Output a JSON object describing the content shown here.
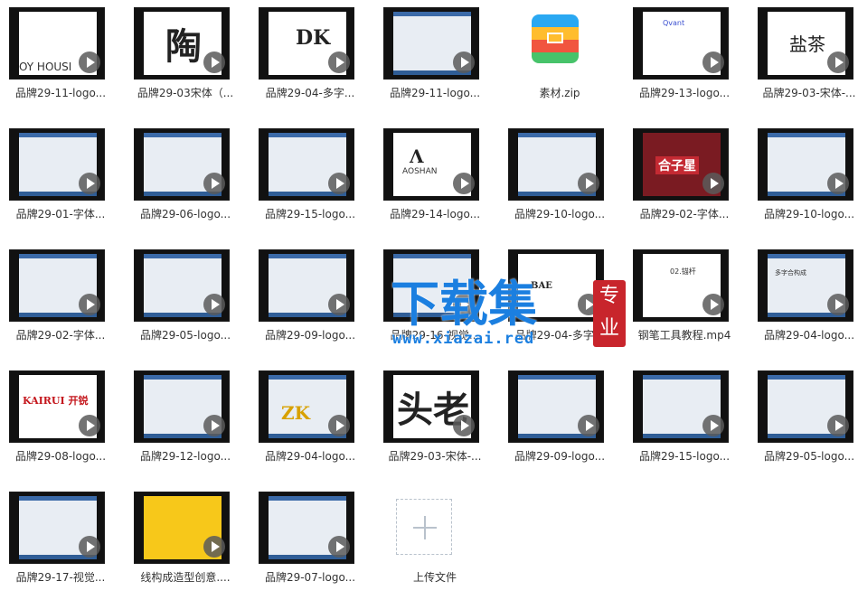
{
  "files": [
    {
      "name": "品牌29-11-logo...",
      "type": "video",
      "thumb_text": "OY HOUSI"
    },
    {
      "name": "品牌29-03宋体（...",
      "type": "video",
      "thumb_text": "陶"
    },
    {
      "name": "品牌29-04-多字...",
      "type": "video",
      "thumb_text": "DK"
    },
    {
      "name": "品牌29-11-logo...",
      "type": "video",
      "thumb_text": ""
    },
    {
      "name": "素材.zip",
      "type": "zip",
      "thumb_text": ""
    },
    {
      "name": "品牌29-13-logo...",
      "type": "video",
      "thumb_text": "Qvant"
    },
    {
      "name": "品牌29-03-宋体-...",
      "type": "video",
      "thumb_text": "盐茶"
    },
    {
      "name": "品牌29-01-字体...",
      "type": "video",
      "thumb_text": ""
    },
    {
      "name": "品牌29-06-logo...",
      "type": "video",
      "thumb_text": ""
    },
    {
      "name": "品牌29-15-logo...",
      "type": "video",
      "thumb_text": ""
    },
    {
      "name": "品牌29-14-logo...",
      "type": "video",
      "thumb_text": "AOSHAN"
    },
    {
      "name": "品牌29-10-logo...",
      "type": "video",
      "thumb_text": ""
    },
    {
      "name": "品牌29-02-字体...",
      "type": "video",
      "thumb_text": "合子星"
    },
    {
      "name": "品牌29-10-logo...",
      "type": "video",
      "thumb_text": ""
    },
    {
      "name": "品牌29-02-字体...",
      "type": "video",
      "thumb_text": ""
    },
    {
      "name": "品牌29-05-logo...",
      "type": "video",
      "thumb_text": ""
    },
    {
      "name": "品牌29-09-logo...",
      "type": "video",
      "thumb_text": ""
    },
    {
      "name": "品牌29-16-视觉...",
      "type": "video",
      "thumb_text": ""
    },
    {
      "name": "品牌29-04-多字...",
      "type": "video",
      "thumb_text": "BAE"
    },
    {
      "name": "钢笔工具教程.mp4",
      "type": "video",
      "thumb_text": "02.锚杆"
    },
    {
      "name": "品牌29-04-logo...",
      "type": "video",
      "thumb_text": "多字合构成"
    },
    {
      "name": "品牌29-08-logo...",
      "type": "video",
      "thumb_text": "KAIRUI 开锐"
    },
    {
      "name": "品牌29-12-logo...",
      "type": "video",
      "thumb_text": ""
    },
    {
      "name": "品牌29-04-logo...",
      "type": "video",
      "thumb_text": "ZK"
    },
    {
      "name": "品牌29-03-宋体-...",
      "type": "video",
      "thumb_text": "头老"
    },
    {
      "name": "品牌29-09-logo...",
      "type": "video",
      "thumb_text": ""
    },
    {
      "name": "品牌29-15-logo...",
      "type": "video",
      "thumb_text": ""
    },
    {
      "name": "品牌29-05-logo...",
      "type": "video",
      "thumb_text": ""
    },
    {
      "name": "品牌29-17-视觉...",
      "type": "video",
      "thumb_text": ""
    },
    {
      "name": "线构成造型创意....",
      "type": "video",
      "thumb_text": ""
    },
    {
      "name": "品牌29-07-logo...",
      "type": "video",
      "thumb_text": ""
    }
  ],
  "upload": {
    "label": "上传文件"
  },
  "watermark": {
    "main": "下载集",
    "seal": "专业",
    "url": "www.xiazai.red"
  },
  "colors": {
    "watermark": "#1b7fe0",
    "seal": "#c8252c",
    "play": "#5a5a5a"
  }
}
